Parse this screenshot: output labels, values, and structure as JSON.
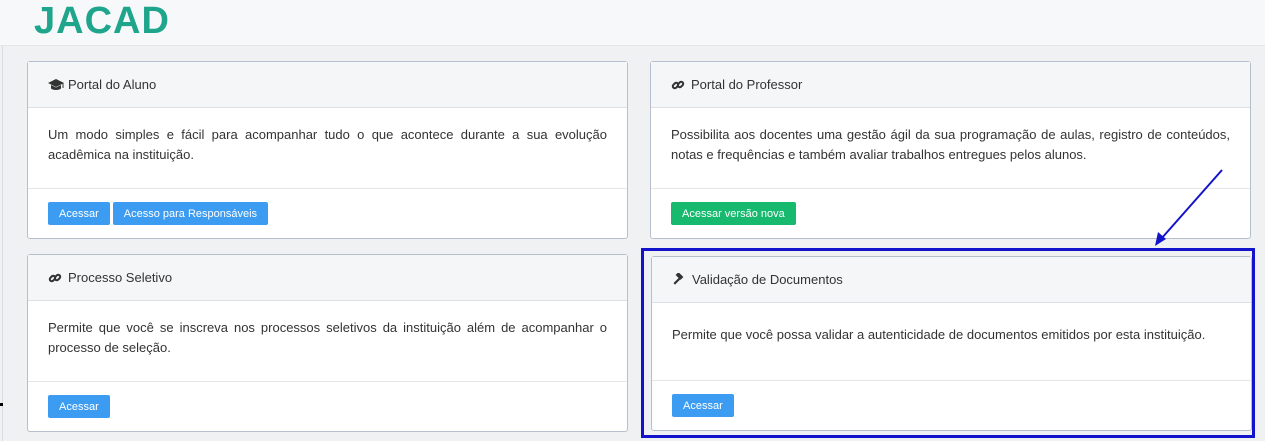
{
  "brand": {
    "logo": "JACAD"
  },
  "cards": {
    "aluno": {
      "icon": "graduation-cap-icon",
      "title": "Portal do Aluno",
      "text": "Um modo simples e fácil para acompanhar tudo o que acontece durante a sua evolução acadêmica na instituição.",
      "buttons": [
        "Acessar",
        "Acesso para Responsáveis"
      ]
    },
    "professor": {
      "icon": "link-icon",
      "title": "Portal do Professor",
      "text": "Possibilita aos docentes uma gestão ágil da sua programação de aulas, registro de conteúdos, notas e frequências e também avaliar trabalhos entregues pelos alunos.",
      "buttons": [
        "Acessar versão nova"
      ]
    },
    "seletivo": {
      "icon": "link-icon",
      "title": "Processo Seletivo",
      "text": "Permite que você se inscreva nos processos seletivos da instituição além de acompanhar o processo de seleção.",
      "buttons": [
        "Acessar"
      ]
    },
    "validacao": {
      "icon": "gavel-icon",
      "title": "Validação de Documentos",
      "text": "Permite que você possa validar a autenticidade de documentos emitidos por esta instituição.",
      "buttons": [
        "Acessar"
      ]
    }
  },
  "colors": {
    "primary_button": "#3c9cf2",
    "success_button": "#16b96d",
    "annotation": "#1313cc",
    "logo": "#1fa58c"
  }
}
